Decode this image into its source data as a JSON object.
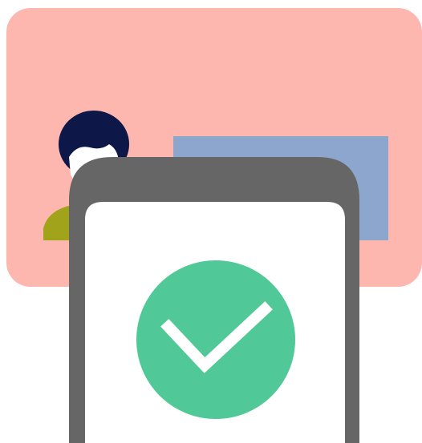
{
  "illustration": {
    "icon": "verification-success-check",
    "colors": {
      "background": "#ffffff",
      "card": "#FDB7AE",
      "screen_panel": "#8CA6CD",
      "person_hair": "#0D1848",
      "person_face": "#ffffff",
      "person_shirt": "#A1A41A",
      "phone_frame": "#666666",
      "phone_screen": "#ffffff",
      "check_circle": "#51C897",
      "check_mark": "#ffffff"
    }
  }
}
